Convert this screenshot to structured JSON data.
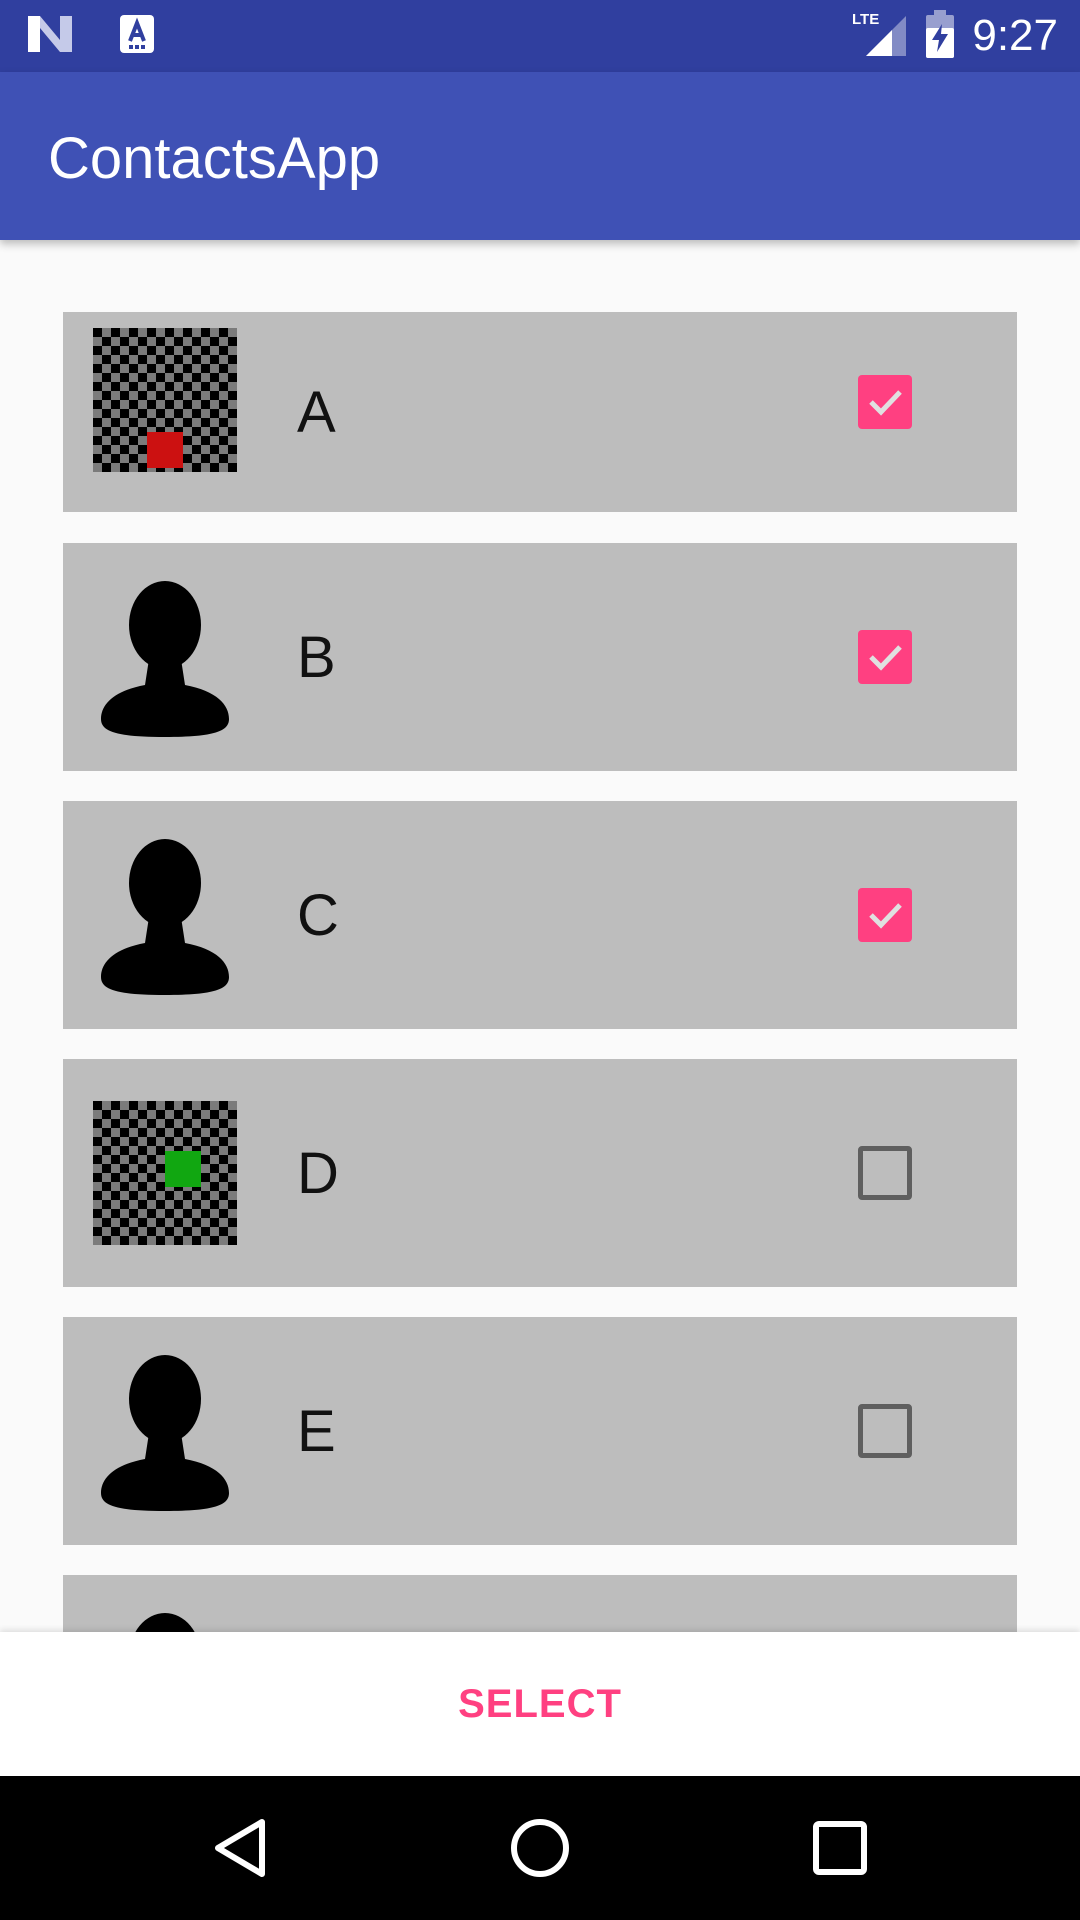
{
  "status_bar": {
    "time": "9:27",
    "network": "LTE",
    "icons": [
      "n-logo-icon",
      "a-notification-icon",
      "lte-signal-icon",
      "battery-charging-icon"
    ]
  },
  "app_bar": {
    "title": "ContactsApp"
  },
  "contacts": [
    {
      "name": "A",
      "avatar": "checker",
      "dot_color": "#cc1111",
      "checked": true
    },
    {
      "name": "B",
      "avatar": "person",
      "checked": true
    },
    {
      "name": "C",
      "avatar": "person",
      "checked": true
    },
    {
      "name": "D",
      "avatar": "checker",
      "dot_color": "#11a711",
      "checked": false
    },
    {
      "name": "E",
      "avatar": "person",
      "checked": false
    },
    {
      "name": "",
      "avatar": "person",
      "checked": false
    }
  ],
  "actions": {
    "select_label": "SELECT"
  },
  "colors": {
    "primary_dark": "#303f9f",
    "primary": "#3f51b5",
    "accent": "#ff4081",
    "row_bg": "#bdbdbd"
  },
  "nav_bar": {
    "icons": [
      "back-icon",
      "home-icon",
      "recents-icon"
    ]
  }
}
